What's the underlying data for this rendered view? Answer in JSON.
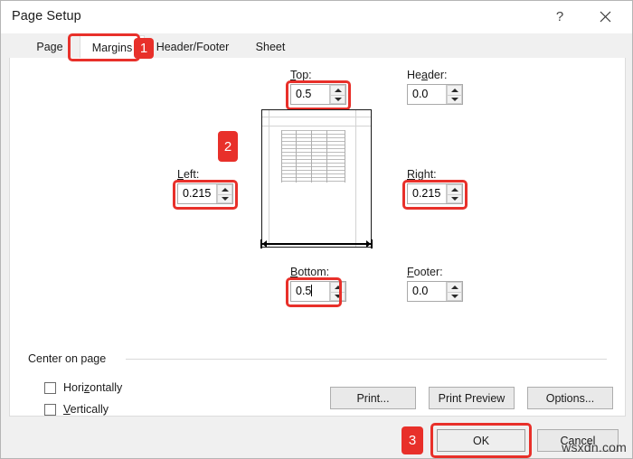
{
  "window": {
    "title": "Page Setup",
    "help_icon": "question-mark-icon",
    "close_icon": "close-icon"
  },
  "tabs": [
    {
      "label": "Page",
      "active": false
    },
    {
      "label": "Margins",
      "active": true
    },
    {
      "label": "Header/Footer",
      "active": false
    },
    {
      "label": "Sheet",
      "active": false
    }
  ],
  "margins": {
    "top": {
      "label": "Top:",
      "accel": "T",
      "value": "0.5",
      "highlighted": true,
      "focused": false
    },
    "header": {
      "label": "Header:",
      "accel": "a",
      "value": "0.0",
      "highlighted": false,
      "focused": false
    },
    "left": {
      "label": "Left:",
      "accel": "L",
      "value": "0.215",
      "highlighted": true,
      "focused": false
    },
    "right": {
      "label": "Right:",
      "accel": "R",
      "value": "0.215",
      "highlighted": true,
      "focused": false
    },
    "bottom": {
      "label": "Bottom:",
      "accel": "B",
      "value": "0.5",
      "highlighted": true,
      "focused": true
    },
    "footer": {
      "label": "Footer:",
      "accel": "F",
      "value": "0.0",
      "highlighted": false,
      "focused": false
    }
  },
  "center_on_page": {
    "legend": "Center on page",
    "horizontally": {
      "label": "Horizontally",
      "accel": "z",
      "checked": false
    },
    "vertically": {
      "label": "Vertically",
      "accel": "V",
      "checked": false
    }
  },
  "buttons": {
    "print": "Print...",
    "print_preview": "Print Preview",
    "options": "Options...",
    "ok": "OK",
    "cancel": "Cancel"
  },
  "badges": {
    "one": "1",
    "two": "2",
    "three": "3"
  },
  "watermark": "wsxdn.com",
  "colors": {
    "accent_red": "#e8302a",
    "dialog_bg": "#f0f0f0",
    "panel_bg": "#ffffff",
    "button_bg": "#e9e9e9"
  }
}
